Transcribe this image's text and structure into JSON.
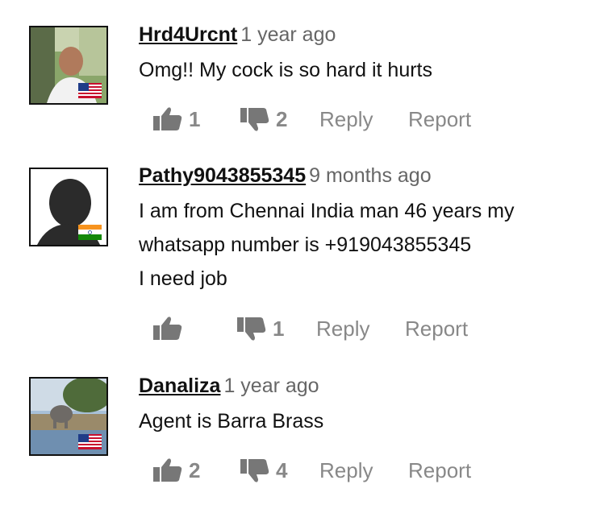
{
  "comments": [
    {
      "username": "Hrd4Urcnt",
      "time": "1 year ago",
      "lines": [
        "Omg!! My cock is so hard it hurts"
      ],
      "likes": "1",
      "dislikes": "2",
      "flag": "us-flag-icon",
      "avatar": "photo-man-avatar"
    },
    {
      "username": "Pathy9043855345",
      "time": "9 months ago",
      "lines": [
        "I am from Chennai India man 46 years my",
        "whatsapp number is +919043855345",
        "I need job"
      ],
      "likes": "",
      "dislikes": "1",
      "flag": "india-flag-icon",
      "avatar": "silhouette-avatar"
    },
    {
      "username": "Danaliza",
      "time": "1 year ago",
      "lines": [
        "Agent is Barra Brass"
      ],
      "likes": "2",
      "dislikes": "4",
      "flag": "us-flag-icon",
      "avatar": "photo-elephant-avatar"
    }
  ],
  "labels": {
    "reply": "Reply",
    "report": "Report"
  },
  "colors": {
    "text": "#111111",
    "muted": "#888888",
    "timestamp": "#666666"
  }
}
